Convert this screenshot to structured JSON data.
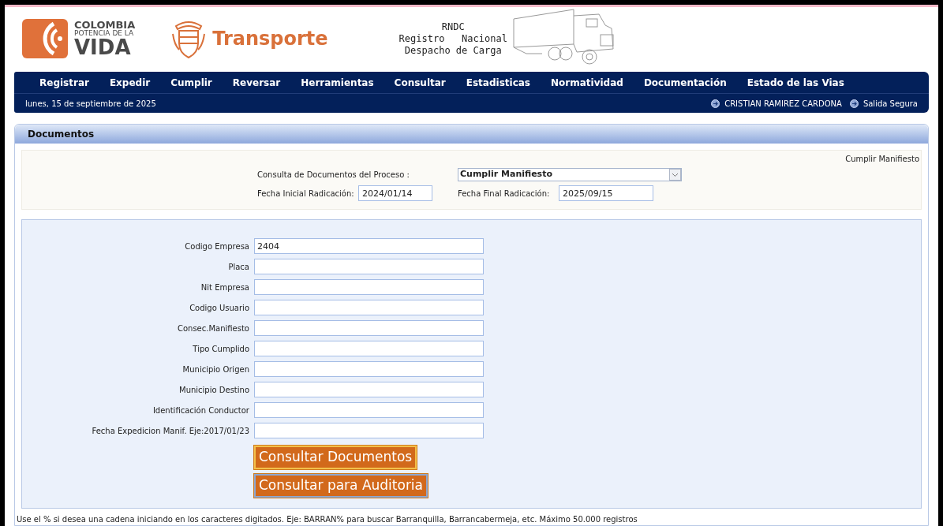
{
  "header": {
    "logo_lines": [
      "COLOMBIA",
      "POTENCIA DE LA",
      "VIDA"
    ],
    "brand": "Transporte",
    "rndc_lines": [
      "RNDC",
      "Registro   Nacional",
      "Despacho de Carga"
    ]
  },
  "nav": {
    "items": [
      "Registrar",
      "Expedir",
      "Cumplir",
      "Reversar",
      "Herramientas",
      "Consultar",
      "Estadisticas",
      "Normatividad",
      "Documentación",
      "Estado de las Vias"
    ],
    "date": "lunes, 15 de septiembre de 2025",
    "user": "CRISTIAN RAMIREZ CARDONA",
    "exit": "Salida Segura"
  },
  "panel": {
    "title": "Documentos",
    "process_caption": "Cumplir Manifiesto",
    "process": {
      "label": "Consulta de Documentos del Proceso :",
      "value": "Cumplir Manifiesto"
    },
    "date_from": {
      "label": "Fecha Inicial Radicación:",
      "value": "2024/01/14"
    },
    "date_to": {
      "label": "Fecha Final Radicación:",
      "value": "2025/09/15"
    },
    "fields": [
      {
        "label": "Codigo Empresa",
        "value": "2404"
      },
      {
        "label": "Placa"
      },
      {
        "label": "Nit Empresa"
      },
      {
        "label": "Codigo Usuario"
      },
      {
        "label": "Consec.Manifiesto"
      },
      {
        "label": "Tipo Cumplido"
      },
      {
        "label": "Municipio Origen"
      },
      {
        "label": "Municipio Destino"
      },
      {
        "label": "Identificación Conductor"
      },
      {
        "label": "Fecha Expedicion Manif. Eje:2017/01/23"
      }
    ],
    "buttons": [
      {
        "label": "Consultar Documentos",
        "kind": "primary"
      },
      {
        "label": "Consultar para Auditoria",
        "kind": "secondary"
      }
    ],
    "note": "Use el % si desea una cadena iniciando en los caracteres digitados. Eje: BARRAN%   para buscar Barranquilla, Barrancabermeja, etc.  Máximo 50.000 registros"
  }
}
